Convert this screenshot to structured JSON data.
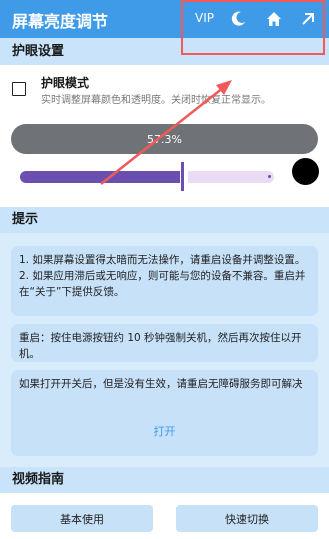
{
  "header": {
    "title": "屏幕亮度调节",
    "vip_label": "VIP",
    "icons": [
      "moon-icon",
      "home-icon",
      "arrow-up-right-icon"
    ]
  },
  "eye_care": {
    "section_title": "护眼设置",
    "mode_title": "护眼模式",
    "mode_description": "实时调整屏幕颜色和透明度。关闭时恢复正常显示。",
    "mode_checked": false
  },
  "brightness": {
    "label": "57.3%",
    "value_percent": 57.3
  },
  "opacity": {
    "value_fraction": 0.63,
    "color": "#000000"
  },
  "tips": {
    "section_title": "提示",
    "card1_line1": "1. 如果屏幕设置得太暗而无法操作，请重启设备并调整设置。",
    "card1_line2": "2. 如果应用滞后或无响应，则可能与您的设备不兼容。重启并在“关于”下提供反馈。",
    "card2": "重启：按住电源按钮约 10 秒钟强制关机，然后再次按住以开机。",
    "card3": "如果打开开关后，但是没有生效，请重启无障碍服务即可解决",
    "open_button": "打开"
  },
  "video_guide": {
    "section_title": "视频指南",
    "basic_button": "基本使用",
    "quick_button": "快速切换"
  },
  "colors": {
    "accent": "#3f9be8",
    "slider": "#6a4fb0",
    "annotation": "#f25a5a"
  }
}
